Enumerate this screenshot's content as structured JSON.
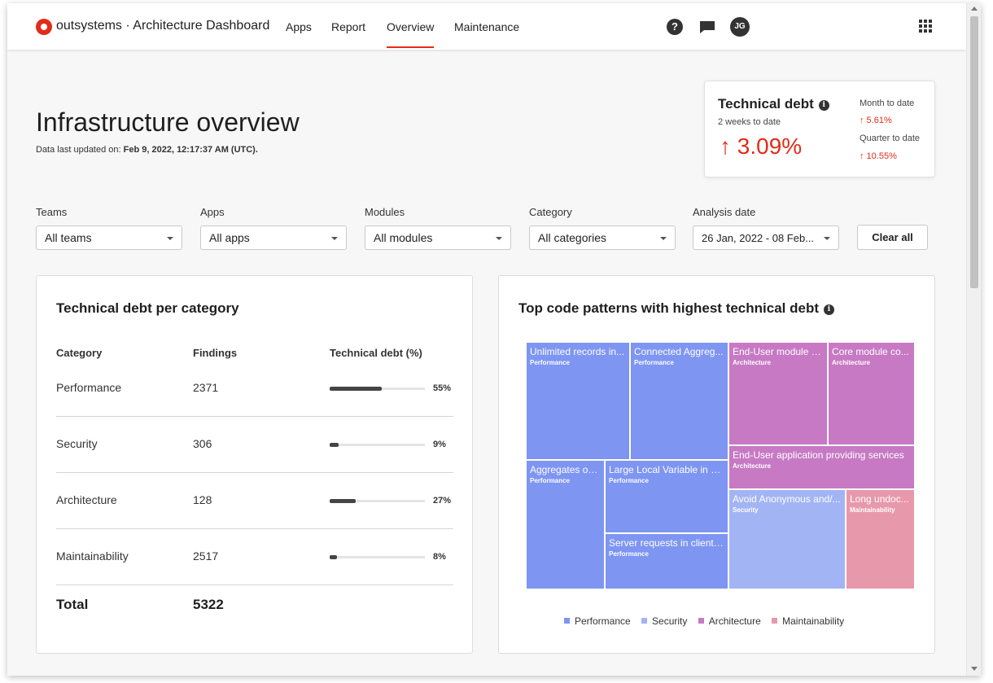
{
  "nav": {
    "brand": "outsystems",
    "app_name": "· Architecture Dashboard",
    "links": [
      "Apps",
      "Report",
      "Overview",
      "Maintenance"
    ],
    "help_glyph": "?",
    "avatar_initials": "JG",
    "icons": [
      "help-icon",
      "chat-icon",
      "avatar",
      "apps-grid-icon"
    ]
  },
  "header": {
    "title": "Infrastructure overview",
    "updated_prefix": "Data last updated on:",
    "updated_value": "Feb 9, 2022, 12:17:37 AM (UTC)."
  },
  "debt_card": {
    "title": "Technical debt",
    "info_glyph": "i",
    "period": "2 weeks to date",
    "value": "↑ 3.09%",
    "month_label": "Month to date",
    "month_value": "↑ 5.61%",
    "quarter_label": "Quarter to date",
    "quarter_value": "↑ 10.55%"
  },
  "filters": {
    "teams": {
      "label": "Teams",
      "value": "All teams"
    },
    "apps": {
      "label": "Apps",
      "value": "All apps"
    },
    "modules": {
      "label": "Modules",
      "value": "All modules"
    },
    "category": {
      "label": "Category",
      "value": "All categories"
    },
    "date": {
      "label": "Analysis date",
      "value": "26 Jan, 2022 - 08 Feb..."
    },
    "clear_label": "Clear all"
  },
  "category_table": {
    "title": "Technical debt per category",
    "columns": [
      "Category",
      "Findings",
      "Technical debt (%)"
    ],
    "rows": [
      {
        "category": "Performance",
        "findings": "2371",
        "pct": 55,
        "pct_label": "55%"
      },
      {
        "category": "Security",
        "findings": "306",
        "pct": 9,
        "pct_label": "9%"
      },
      {
        "category": "Architecture",
        "findings": "128",
        "pct": 27,
        "pct_label": "27%"
      },
      {
        "category": "Maintainability",
        "findings": "2517",
        "pct": 8,
        "pct_label": "8%"
      }
    ],
    "total_label": "Total",
    "total_value": "5322"
  },
  "treemap": {
    "title": "Top code patterns with highest technical debt",
    "info_glyph": "i",
    "colors": {
      "Performance": "#7e95f2",
      "Security": "#a3b4f5",
      "Architecture": "#c779c4",
      "Maintainability": "#e898ab"
    },
    "cells": [
      {
        "name": "Unlimited records in...",
        "category": "Performance"
      },
      {
        "name": "Connected Aggreg...",
        "category": "Performance"
      },
      {
        "name": "End-User module p...",
        "category": "Architecture"
      },
      {
        "name": "Core module co...",
        "category": "Architecture"
      },
      {
        "name": "End-User application providing services",
        "category": "Architecture"
      },
      {
        "name": "Aggregates or ...",
        "category": "Performance"
      },
      {
        "name": "Large Local Variable in Vi...",
        "category": "Performance"
      },
      {
        "name": "Server requests in client ...",
        "category": "Performance"
      },
      {
        "name": "Avoid Anonymous and/...",
        "category": "Security"
      },
      {
        "name": "Long undoc...",
        "category": "Maintainability"
      }
    ],
    "legend": [
      "Performance",
      "Security",
      "Architecture",
      "Maintainability"
    ]
  }
}
